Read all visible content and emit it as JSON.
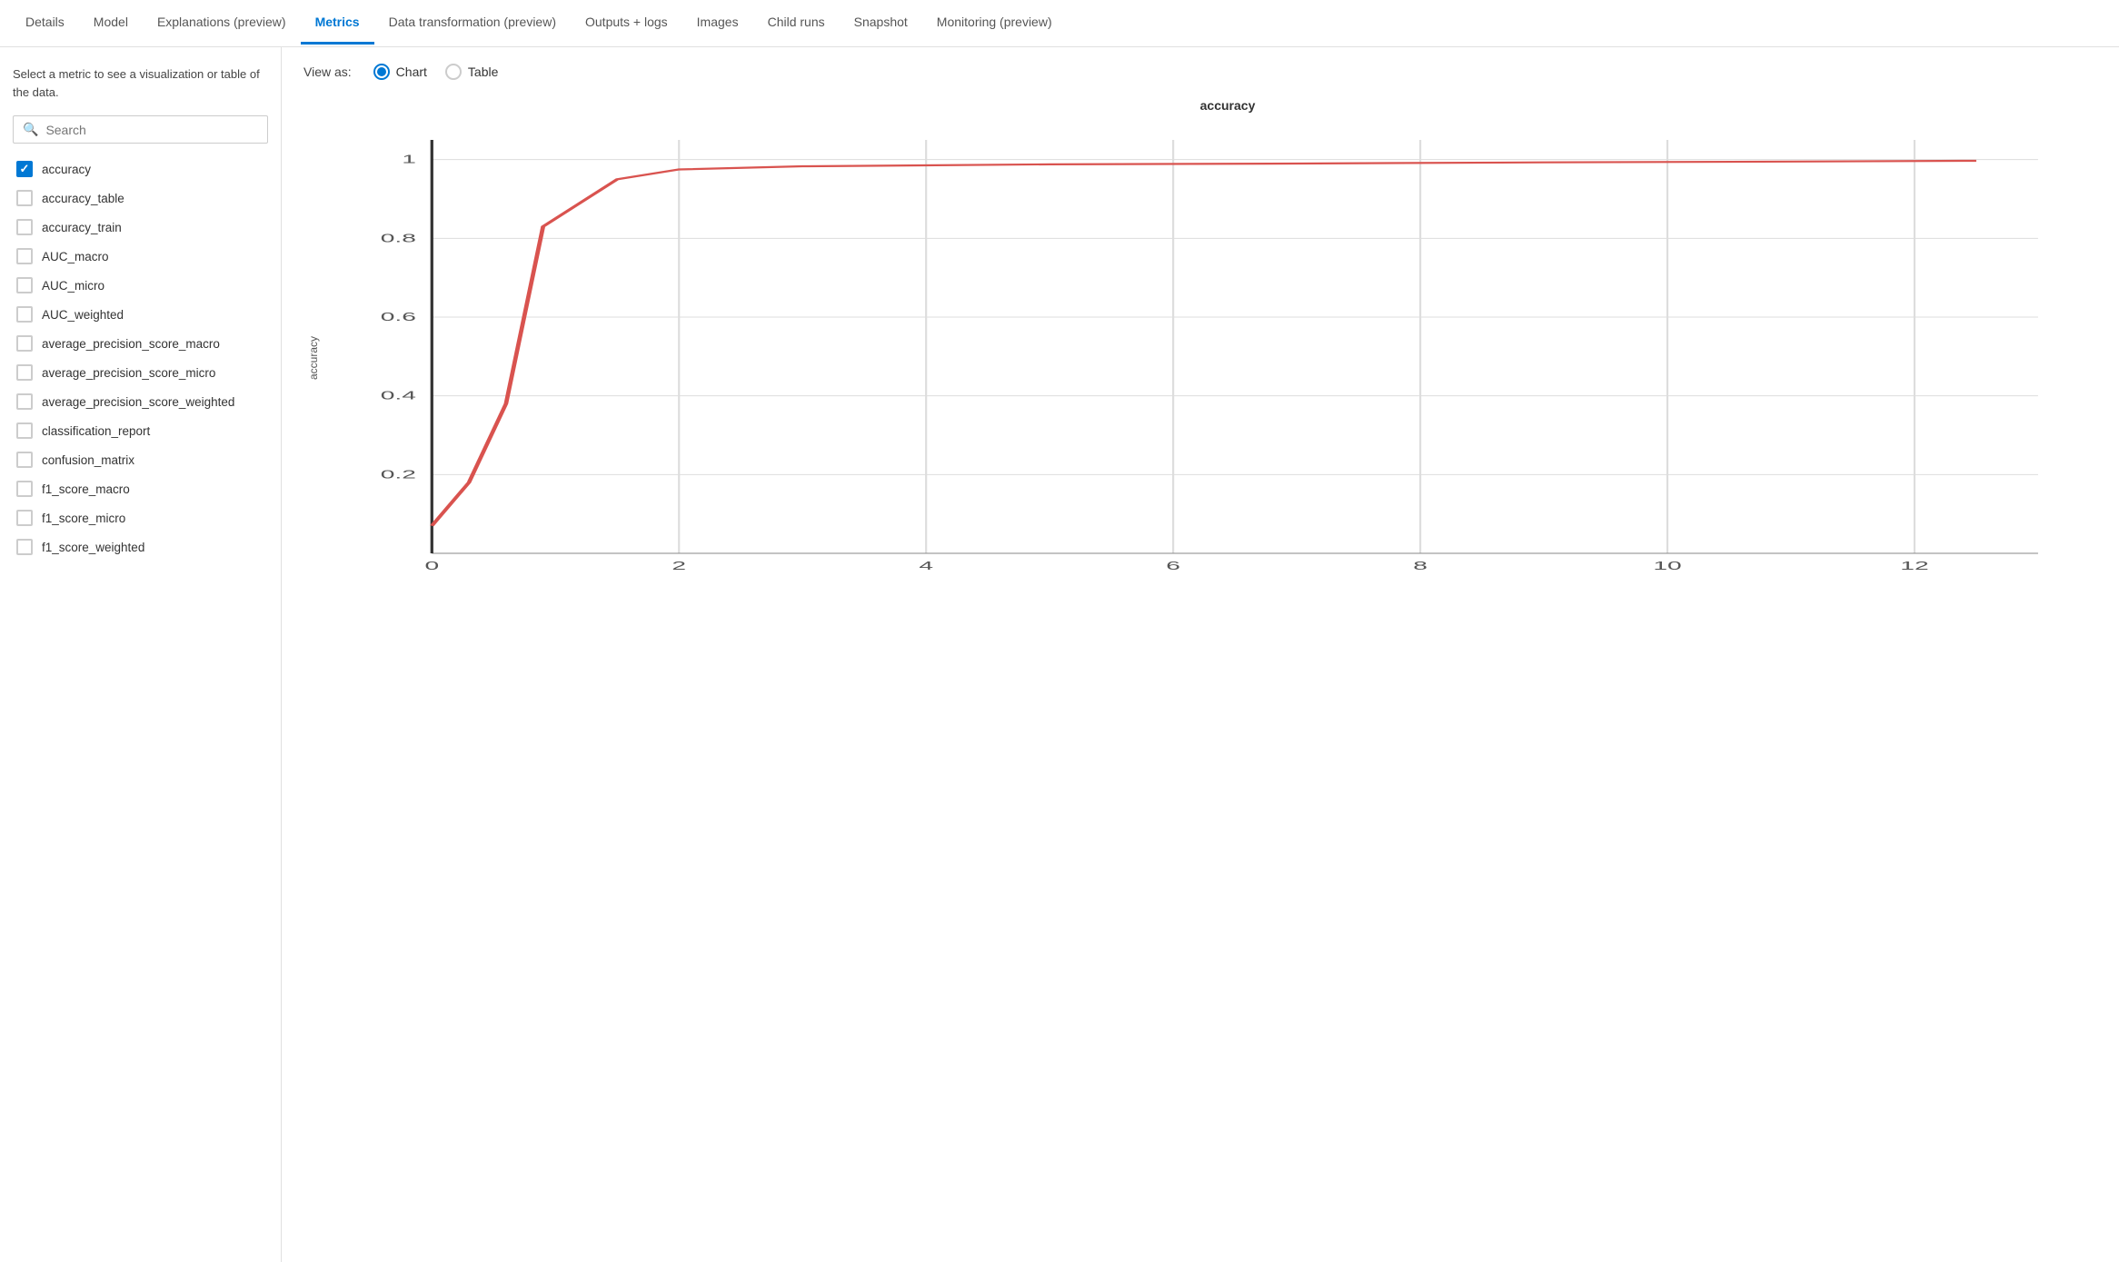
{
  "nav": {
    "tabs": [
      {
        "id": "details",
        "label": "Details",
        "active": false
      },
      {
        "id": "model",
        "label": "Model",
        "active": false
      },
      {
        "id": "explanations",
        "label": "Explanations (preview)",
        "active": false
      },
      {
        "id": "metrics",
        "label": "Metrics",
        "active": true
      },
      {
        "id": "data-transformation",
        "label": "Data transformation (preview)",
        "active": false
      },
      {
        "id": "outputs-logs",
        "label": "Outputs + logs",
        "active": false
      },
      {
        "id": "images",
        "label": "Images",
        "active": false
      },
      {
        "id": "child-runs",
        "label": "Child runs",
        "active": false
      },
      {
        "id": "snapshot",
        "label": "Snapshot",
        "active": false
      },
      {
        "id": "monitoring",
        "label": "Monitoring (preview)",
        "active": false
      }
    ]
  },
  "sidebar": {
    "description": "Select a metric to see a visualization or table of the data.",
    "search": {
      "placeholder": "Search"
    },
    "metrics": [
      {
        "id": "accuracy",
        "label": "accuracy",
        "checked": true
      },
      {
        "id": "accuracy_table",
        "label": "accuracy_table",
        "checked": false
      },
      {
        "id": "accuracy_train",
        "label": "accuracy_train",
        "checked": false
      },
      {
        "id": "auc_macro",
        "label": "AUC_macro",
        "checked": false
      },
      {
        "id": "auc_micro",
        "label": "AUC_micro",
        "checked": false
      },
      {
        "id": "auc_weighted",
        "label": "AUC_weighted",
        "checked": false
      },
      {
        "id": "average_precision_macro",
        "label": "average_precision_score_macro",
        "checked": false
      },
      {
        "id": "average_precision_micro",
        "label": "average_precision_score_micro",
        "checked": false
      },
      {
        "id": "average_precision_weighted",
        "label": "average_precision_score_weighted",
        "checked": false
      },
      {
        "id": "classification_report",
        "label": "classification_report",
        "checked": false
      },
      {
        "id": "confusion_matrix",
        "label": "confusion_matrix",
        "checked": false
      },
      {
        "id": "f1_score_macro",
        "label": "f1_score_macro",
        "checked": false
      },
      {
        "id": "f1_score_micro",
        "label": "f1_score_micro",
        "checked": false
      },
      {
        "id": "f1_score_weighted",
        "label": "f1_score_weighted",
        "checked": false
      }
    ]
  },
  "view_as": {
    "label": "View as:",
    "options": [
      {
        "id": "chart",
        "label": "Chart",
        "selected": true
      },
      {
        "id": "table",
        "label": "Table",
        "selected": false
      }
    ]
  },
  "chart": {
    "title": "accuracy",
    "y_axis_label": "accuracy",
    "x_ticks": [
      "0",
      "2",
      "4",
      "6",
      "8",
      "10",
      "12"
    ],
    "y_ticks": [
      "0.2",
      "0.4",
      "0.6",
      "0.8",
      "1"
    ],
    "line_color": "#d9534f",
    "data_points": [
      {
        "x": 0,
        "y": 0.07
      },
      {
        "x": 0.3,
        "y": 0.18
      },
      {
        "x": 0.6,
        "y": 0.38
      },
      {
        "x": 0.9,
        "y": 0.83
      },
      {
        "x": 1.5,
        "y": 0.95
      },
      {
        "x": 2.0,
        "y": 0.975
      },
      {
        "x": 3.0,
        "y": 0.983
      },
      {
        "x": 5.0,
        "y": 0.988
      },
      {
        "x": 7.0,
        "y": 0.99
      },
      {
        "x": 9.0,
        "y": 0.993
      },
      {
        "x": 11.0,
        "y": 0.995
      },
      {
        "x": 12.5,
        "y": 0.997
      }
    ]
  }
}
